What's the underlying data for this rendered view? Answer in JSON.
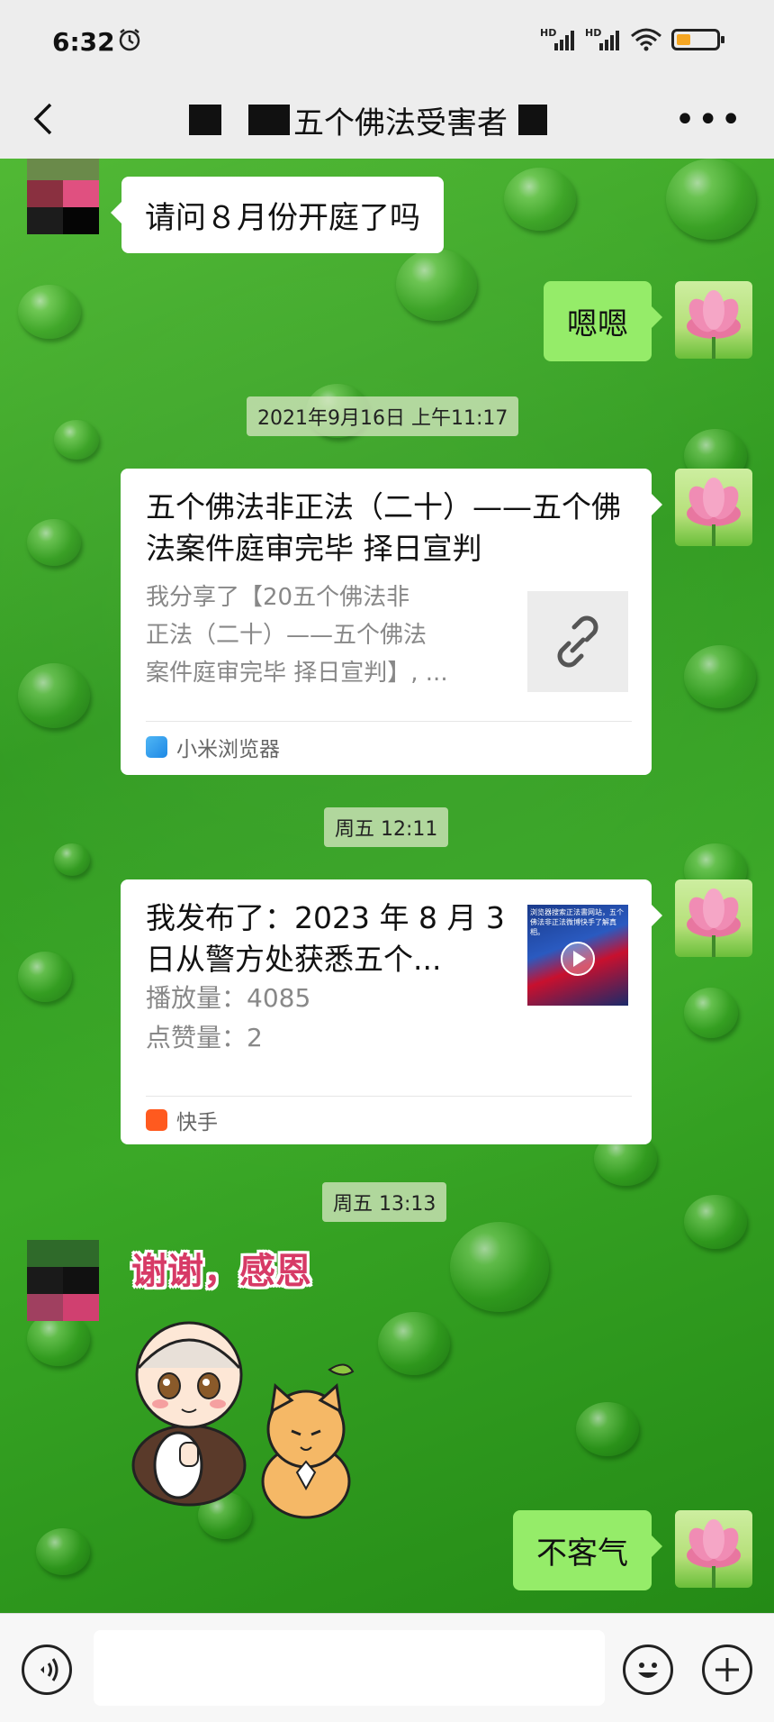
{
  "status_bar": {
    "time": "6:32",
    "network_1": "HD",
    "network_2": "HD",
    "battery_level": 0.35,
    "battery_color": "#f5a623"
  },
  "header": {
    "title": "五个佛法受害者",
    "back_icon": "chevron-left-icon",
    "more_icon": "more-icon"
  },
  "messages": [
    {
      "sender": "other",
      "type": "text",
      "text": "请问８月份开庭了吗"
    },
    {
      "sender": "me",
      "type": "text",
      "text": "嗯嗯"
    },
    {
      "type": "timestamp",
      "text": "2021年9月16日 上午11:17"
    },
    {
      "sender": "me",
      "type": "link-card",
      "title": "五个佛法非正法（二十）——五个佛法案件庭审完毕 择日宣判",
      "desc": [
        "我分享了【20五个佛法非",
        "正法（二十）——五个佛法",
        "案件庭审完毕 择日宣判】, ..."
      ],
      "source": "小米浏览器",
      "source_icon": "xiaomi-browser-icon"
    },
    {
      "type": "timestamp",
      "text": "周五 12:11"
    },
    {
      "sender": "me",
      "type": "video-card",
      "title": "我发布了：2023 年 8 月 3 日从警方处获悉五个...",
      "plays": "播放量：4085",
      "likes": "点赞量：2",
      "source": "快手",
      "source_icon": "kuaishou-icon",
      "thumb_text": "浏览器搜索正法書网站，五个佛法非正法微博快手了解真相。"
    },
    {
      "type": "timestamp",
      "text": "周五 13:13"
    },
    {
      "sender": "other",
      "type": "sticker",
      "text": "谢谢，感恩"
    },
    {
      "sender": "me",
      "type": "text",
      "text": "不客气"
    }
  ],
  "input_bar": {
    "voice_icon": "voice-icon",
    "emoji_icon": "emoji-icon",
    "plus_icon": "plus-icon",
    "placeholder": ""
  },
  "colors": {
    "bubble_me": "#95ec69",
    "bubble_other": "#ffffff",
    "chat_bg": "#3aa826"
  }
}
